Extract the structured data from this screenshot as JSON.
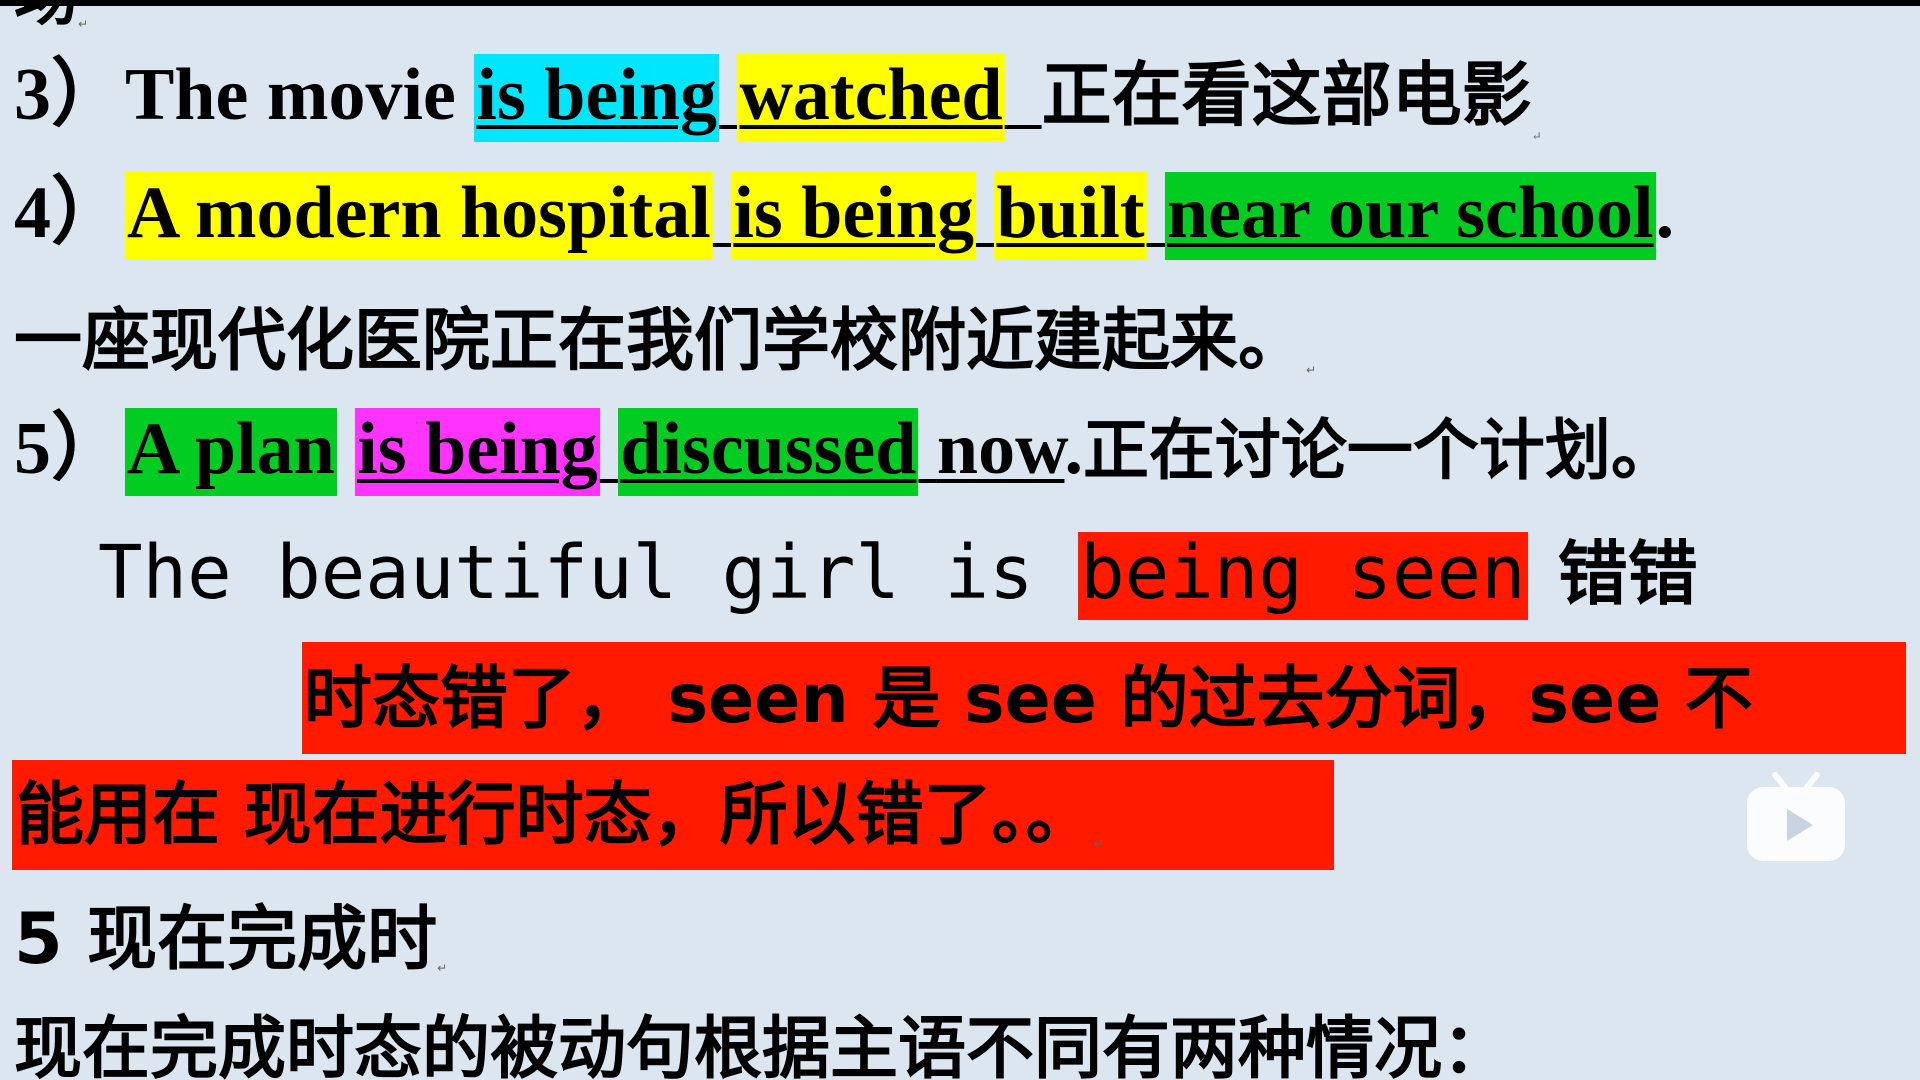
{
  "line_top_fragment": "场",
  "item3": {
    "num": "3）",
    "subj": "The movie ",
    "p1": "is being",
    "p2": "watched",
    "cn": "正在看这部电影"
  },
  "item4": {
    "num": "4）",
    "p1": "A modern hospital",
    "p2": "is being",
    "p3": "built",
    "p4": "near our school",
    "end": ".",
    "cn": "一座现代化医院正在我们学校附近建起来。"
  },
  "item5": {
    "num": "5）",
    "p1": "A plan",
    "p2": "is being",
    "p3": "discussed",
    "p4": "now",
    "end": ".",
    "cn": "正在讨论一个计划。"
  },
  "wrong": {
    "pre": "The beautiful girl is ",
    "hl": "being seen",
    "label": "错错"
  },
  "note": {
    "line1": "时态错了， seen 是 see 的过去分词，see 不",
    "line2": "能用在 现在进行时态，所以错了。。"
  },
  "section": {
    "title": "5 现在完成时",
    "desc": "现在完成时态的被动句根据主语不同有两种情况："
  },
  "paragraph_mark": "↵",
  "icons": {
    "player": "play-icon"
  },
  "colors": {
    "cyan": "#00e6ff",
    "yellow": "#ffff00",
    "green": "#00cc22",
    "magenta": "#ff33ff",
    "red": "#ff1a00",
    "bg": "#dce6f1"
  }
}
